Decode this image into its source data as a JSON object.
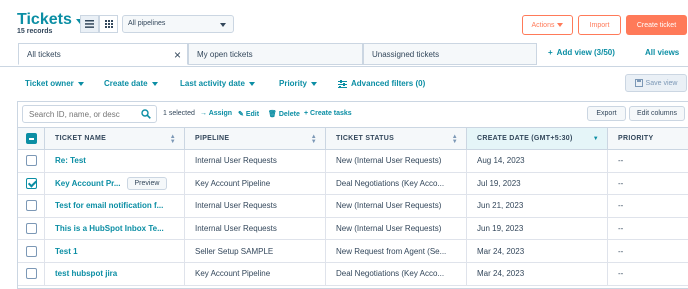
{
  "header": {
    "title": "Tickets",
    "records": "15 records",
    "pipeline": "All pipelines",
    "actions_label": "Actions",
    "import_label": "Import",
    "create_label": "Create ticket"
  },
  "tabs": [
    {
      "label": "All tickets"
    },
    {
      "label": "My open tickets"
    },
    {
      "label": "Unassigned tickets"
    }
  ],
  "add_view": "Add view (3/50)",
  "all_views": "All views",
  "filters": {
    "owner": "Ticket owner",
    "create_date": "Create date",
    "last_activity": "Last activity date",
    "priority": "Priority",
    "advanced": "Advanced filters (0)",
    "save_view": "Save view"
  },
  "toolbar": {
    "search_placeholder": "Search ID, name, or desc",
    "selected": "1 selected",
    "assign": "Assign",
    "edit": "Edit",
    "delete": "Delete",
    "create_tasks": "Create tasks",
    "export": "Export",
    "edit_columns": "Edit columns"
  },
  "table": {
    "columns": [
      "TICKET NAME",
      "PIPELINE",
      "TICKET STATUS",
      "CREATE DATE (GMT+5:30)",
      "PRIORITY"
    ],
    "preview_label": "Preview",
    "rows": [
      {
        "name": "Re: Test",
        "pipeline": "Internal User Requests",
        "status": "New (Internal User Requests)",
        "date": "Aug 14, 2023",
        "priority": "--"
      },
      {
        "name": "Key Account Pr...",
        "pipeline": "Key Account Pipeline",
        "status": "Deal Negotiations (Key Acco...",
        "date": "Jul 19, 2023",
        "priority": "--"
      },
      {
        "name": "Test for email notification f...",
        "pipeline": "Internal User Requests",
        "status": "New (Internal User Requests)",
        "date": "Jun 21, 2023",
        "priority": "--"
      },
      {
        "name": "This is a HubSpot Inbox Te...",
        "pipeline": "Internal User Requests",
        "status": "New (Internal User Requests)",
        "date": "Jun 19, 2023",
        "priority": "--"
      },
      {
        "name": "Test 1",
        "pipeline": "Seller Setup SAMPLE",
        "status": "New Request from Agent (Se...",
        "date": "Mar 24, 2023",
        "priority": "--"
      },
      {
        "name": "test hubspot jira",
        "pipeline": "Key Account Pipeline",
        "status": "Deal Negotiations (Key Acco...",
        "date": "Mar 24, 2023",
        "priority": "--"
      }
    ]
  }
}
